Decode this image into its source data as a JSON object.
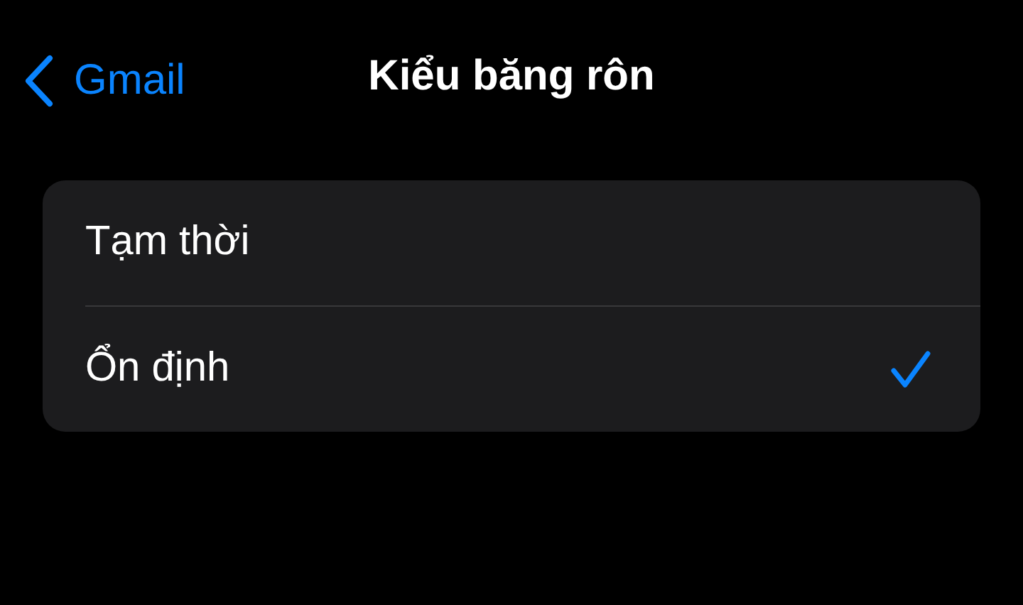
{
  "nav": {
    "back_label": "Gmail",
    "title": "Kiểu băng rôn"
  },
  "options": [
    {
      "label": "Tạm thời",
      "selected": false
    },
    {
      "label": "Ổn định",
      "selected": true
    }
  ]
}
